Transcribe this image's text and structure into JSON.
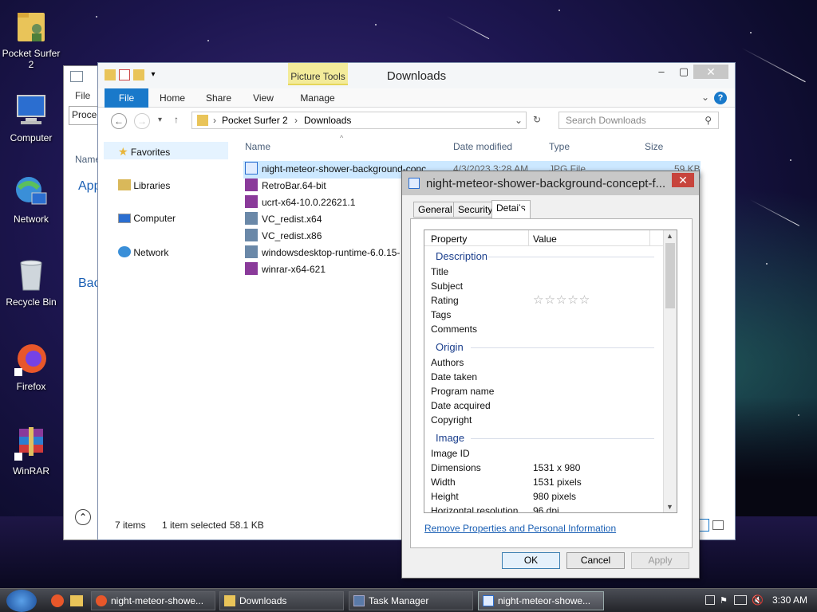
{
  "desktop": {
    "icons": [
      {
        "label": "Pocket Surfer 2",
        "icon": "folder-user-icon"
      },
      {
        "label": "Computer",
        "icon": "computer-icon"
      },
      {
        "label": "Network",
        "icon": "network-icon"
      },
      {
        "label": "Recycle Bin",
        "icon": "recycle-bin-icon"
      },
      {
        "label": "Firefox",
        "icon": "firefox-icon"
      },
      {
        "label": "WinRAR",
        "icon": "winrar-icon"
      }
    ]
  },
  "bgwindow": {
    "file_tab": "File",
    "proc": "Proce",
    "name": "Name",
    "app": "App",
    "bac": "Bac"
  },
  "explorer": {
    "title": "Downloads",
    "context_tab": "Picture Tools",
    "tabs": [
      "File",
      "Home",
      "Share",
      "View",
      "Manage"
    ],
    "address": {
      "segments": [
        "Pocket Surfer 2",
        "Downloads"
      ]
    },
    "search_placeholder": "Search Downloads",
    "nav": {
      "favorites": "Favorites",
      "libraries": "Libraries",
      "computer": "Computer",
      "network": "Network"
    },
    "columns": {
      "name": "Name",
      "date": "Date modified",
      "type": "Type",
      "size": "Size"
    },
    "files": [
      {
        "name": "night-meteor-shower-background-conc",
        "date": "4/3/2023 3:28 AM",
        "type": "JPG File",
        "size": "59 KB"
      },
      {
        "name": "RetroBar.64-bit"
      },
      {
        "name": "ucrt-x64-10.0.22621.1"
      },
      {
        "name": "VC_redist.x64"
      },
      {
        "name": "VC_redist.x86"
      },
      {
        "name": "windowsdesktop-runtime-6.0.15-"
      },
      {
        "name": "winrar-x64-621"
      }
    ],
    "status": {
      "items": "7 items",
      "selected": "1 item selected",
      "size": "58.1 KB"
    }
  },
  "dialog": {
    "title": "night-meteor-shower-background-concept-f...",
    "tabs": [
      "General",
      "Security",
      "Details"
    ],
    "header": {
      "property": "Property",
      "value": "Value"
    },
    "sections": {
      "description": "Description",
      "origin": "Origin",
      "image": "Image"
    },
    "rows": {
      "title": "Title",
      "subject": "Subject",
      "rating": "Rating",
      "tags": "Tags",
      "comments": "Comments",
      "authors": "Authors",
      "date_taken": "Date taken",
      "program_name": "Program name",
      "date_acquired": "Date acquired",
      "copyright": "Copyright",
      "image_id": "Image ID",
      "dimensions": "Dimensions",
      "width": "Width",
      "height": "Height",
      "hres": "Horizontal resolution"
    },
    "values": {
      "rating_stars": "☆☆☆☆☆",
      "dimensions": "1531 x 980",
      "width": "1531 pixels",
      "height": "980 pixels",
      "hres": "96 dpi"
    },
    "remove_link": "Remove Properties and Personal Information",
    "buttons": {
      "ok": "OK",
      "cancel": "Cancel",
      "apply": "Apply"
    }
  },
  "taskbar": {
    "items": [
      {
        "label": "night-meteor-showe..."
      },
      {
        "label": "Downloads"
      },
      {
        "label": "Task Manager"
      },
      {
        "label": "night-meteor-showe..."
      }
    ],
    "clock": "3:30 AM"
  }
}
